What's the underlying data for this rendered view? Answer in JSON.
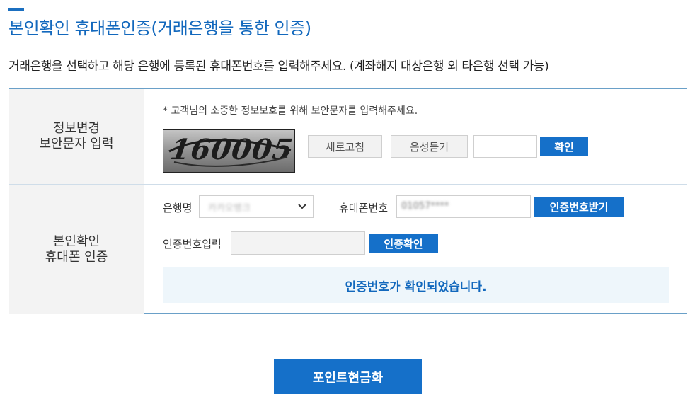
{
  "page": {
    "title": "본인확인 휴대폰인증(거래은행을 통한 인증)",
    "subtitle": "거래은행을 선택하고 해당 은행에 등록된 휴대폰번호를 입력해주세요. (계좌해지 대상은행 외 타은행 선택 가능)"
  },
  "captcha_row": {
    "heading_line1": "정보변경",
    "heading_line2": "보안문자 입력",
    "note": "* 고객님의 소중한 정보보호를 위해 보안문자를 입력해주세요.",
    "captcha_text": "160005",
    "refresh_label": "새로고침",
    "audio_label": "음성듣기",
    "input_value": "",
    "confirm_label": "확인"
  },
  "phone_row": {
    "heading_line1": "본인확인",
    "heading_line2": "휴대폰 인증",
    "bank_label": "은행명",
    "bank_value": "카카오뱅크",
    "phone_label": "휴대폰번호",
    "phone_value": "01057****",
    "request_code_label": "인증번호받기",
    "code_label": "인증번호입력",
    "code_value": "",
    "verify_label": "인증확인",
    "status_message": "인증번호가 확인되었습니다."
  },
  "submit": {
    "label": "포인트현금화"
  },
  "icons": {
    "select_arrow": "chevron-down-icon"
  },
  "colors": {
    "accent": "#1570c9",
    "title": "#1268bd",
    "status_bg": "#eef6fb"
  }
}
